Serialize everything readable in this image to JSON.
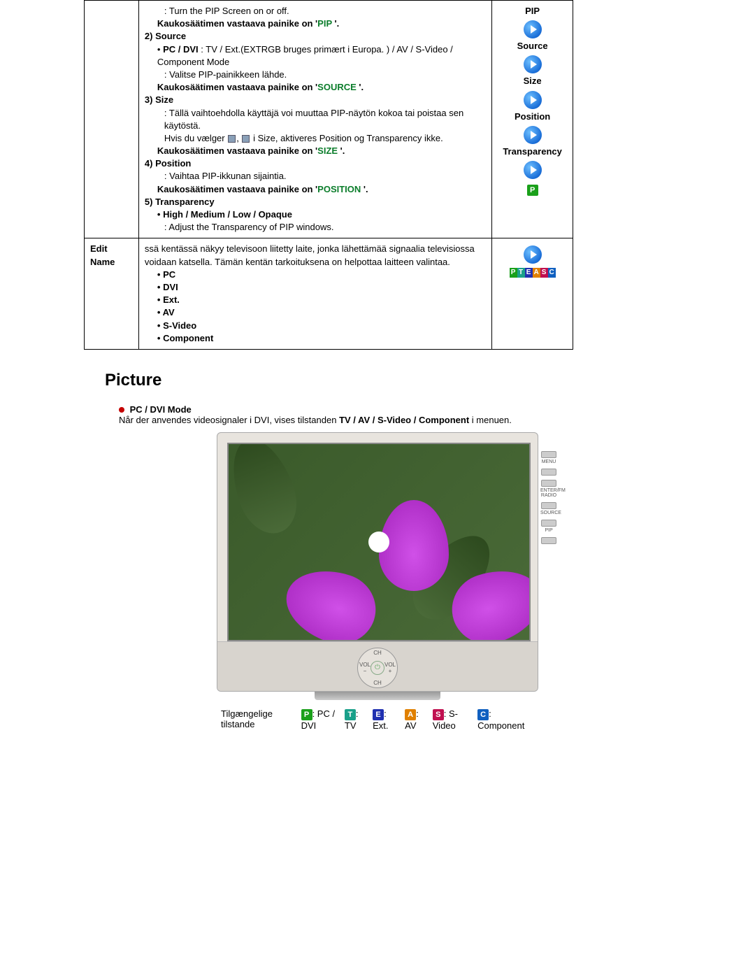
{
  "table": {
    "row1": {
      "lines": {
        "l1": ": Turn the PIP Screen on or off.",
        "remote_prefix": "Kaukosäätimen vastaava painike on '",
        "remote_pip": "PIP",
        "remote_suffix": " '.",
        "source_h": "2) Source",
        "source_a_pre": "• ",
        "source_a_bold": "PC / DVI",
        "source_a_post": " : TV / Ext.(EXTRGB bruges primært i Europa. ) / AV / S-Video / Component Mode",
        "source_b": ": Valitse PIP-painikkeen lähde.",
        "remote_source": "SOURCE",
        "size_h": "3) Size",
        "size_a": ": Tällä vaihtoehdolla käyttäjä voi muuttaa PIP-näytön kokoa tai poistaa sen käytöstä.",
        "size_b_pre": "Hvis du vælger ",
        "size_b_post": " i Size, aktiveres Position og Transparency ikke.",
        "remote_size": "SIZE",
        "pos_h": "4) Position",
        "pos_a": ": Vaihtaa PIP-ikkunan sijaintia.",
        "remote_pos": "POSITION",
        "trans_h": "5) Transparency",
        "trans_opts": "• High / Medium / Low / Opaque",
        "trans_a": ": Adjust the Transparency of PIP windows."
      },
      "icons": {
        "pip": "PIP",
        "source": "Source",
        "size": "Size",
        "position": "Position",
        "transparency": "Transparency"
      }
    },
    "row2": {
      "label": "Edit Name",
      "desc": "ssä kentässä näkyy televisoon liitetty laite, jonka lähettämää signaalia televisiossa voidaan katsella. Tämän kentän tarkoituksena on helpottaa laitteen valintaa.",
      "items": {
        "i1": "• PC",
        "i2": "• DVI",
        "i3": "• Ext.",
        "i4": "• AV",
        "i5": "• S-Video",
        "i6": "• Component"
      },
      "pteascbar": {
        "p": "P",
        "t": "T",
        "e": "E",
        "a": "A",
        "s": "S",
        "c": "C"
      }
    }
  },
  "section": {
    "title": "Picture",
    "mode_header": "PC / DVI Mode",
    "mode_desc_pre": "Når der anvendes videosignaler i DVI, vises tilstanden ",
    "mode_desc_bold": "TV / AV / S-Video / Component",
    "mode_desc_post": " i menuen."
  },
  "monitor_side": {
    "menu": "MENU",
    "enter": "ENTER/FM RADIO",
    "source": "SOURCE",
    "pip": "PIP"
  },
  "monitor_ctrl": {
    "ch_up": "CH",
    "ch_dn": "CH",
    "vol_m": "VOL\n−",
    "vol_p": "VOL\n+"
  },
  "states": {
    "label": "Tilgængelige tilstande",
    "p": ": PC / DVI",
    "t": ": TV",
    "e": ": Ext.",
    "a": ": AV",
    "s": ": S-Video",
    "c": ": Component"
  },
  "badges": {
    "P": "P",
    "T": "T",
    "E": "E",
    "A": "A",
    "S": "S",
    "C": "C"
  }
}
